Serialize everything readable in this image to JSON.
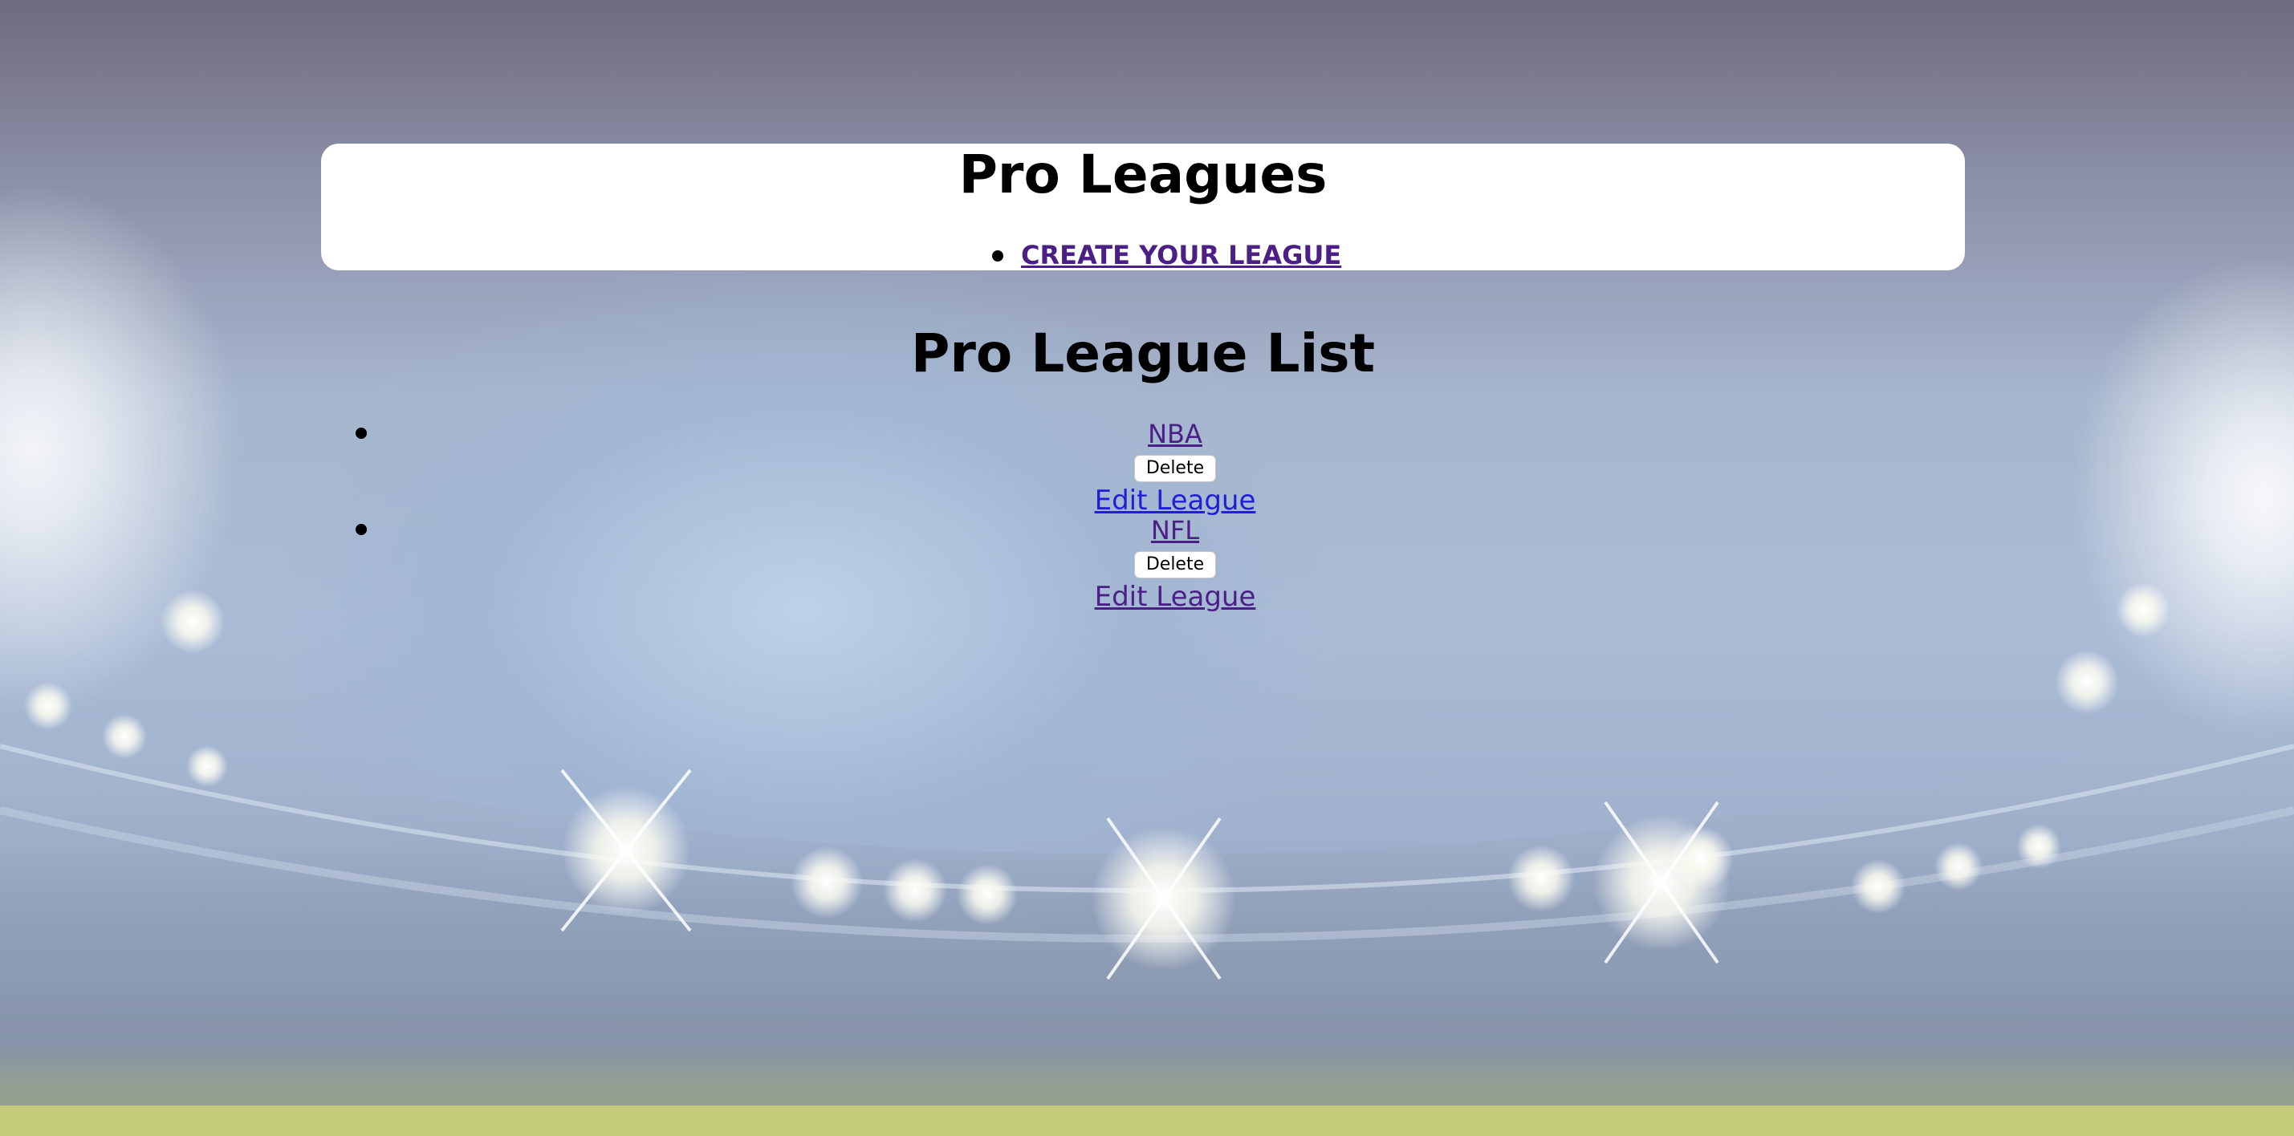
{
  "header": {
    "title": "Pro Leagues",
    "nav": [
      {
        "label": "CREATE YOUR LEAGUE"
      }
    ]
  },
  "main": {
    "title": "Pro League List",
    "leagues": [
      {
        "name": "NBA",
        "delete_label": "Delete",
        "edit_label": "Edit League"
      },
      {
        "name": "NFL",
        "delete_label": "Delete",
        "edit_label": "Edit League"
      }
    ]
  },
  "colors": {
    "link": "#4b1f86",
    "link_unvisited": "#1f1fd6",
    "card": "#ffffff"
  }
}
